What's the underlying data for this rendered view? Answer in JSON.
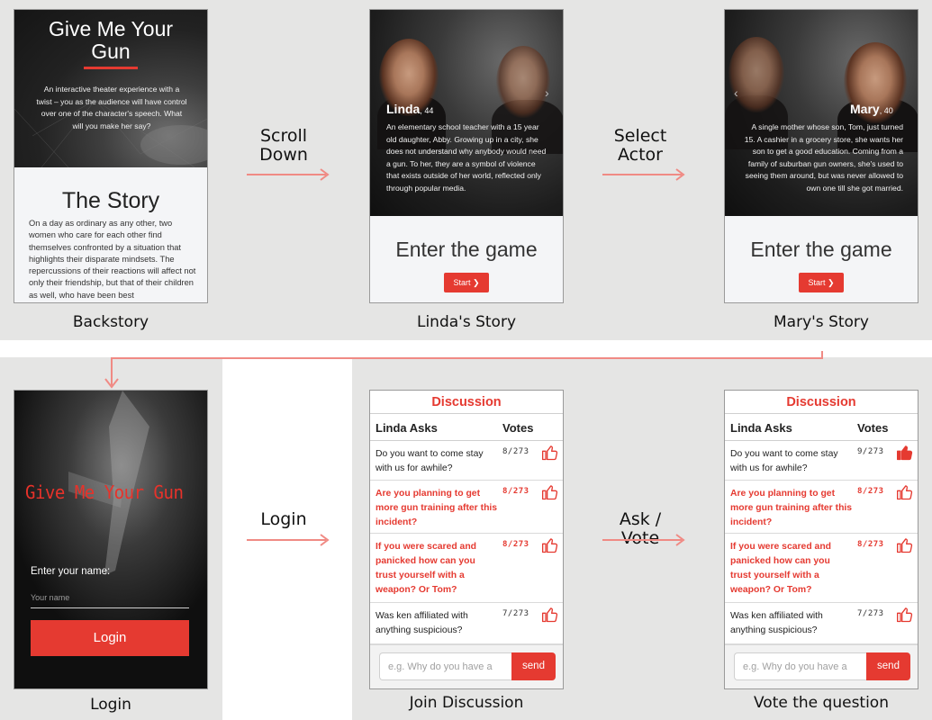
{
  "panels": {
    "backstory": {
      "caption": "Backstory",
      "title_line1": "Give Me Your",
      "title_line2": "Gun",
      "intro": "An interactive theater experience with a twist – you as the audience will have control over one of the character's speech. What will you make her say?",
      "story_heading": "The Story",
      "story_text": "On a day as ordinary as any other, two women who care for each other find themselves confronted by a situation that highlights their disparate mindsets. The repercussions of their reactions will affect not only their friendship, but that of their children as well, who have been best"
    },
    "linda_story": {
      "caption": "Linda's Story",
      "name": "Linda",
      "age": ", 44",
      "bio": "An elementary school teacher with a 15 year old daughter, Abby. Growing up in a city, she does not understand why anybody would need a gun. To her, they are a symbol of violence that exists outside of her world, reflected only through popular media.",
      "enter_label": "Enter the game",
      "start_label": "Start"
    },
    "mary_story": {
      "caption": "Mary's Story",
      "name": "Mary",
      "age": ", 40",
      "bio": "A single mother whose son, Tom, just turned 15. A cashier in a grocery store, she wants her son to get a good education. Coming from a family of suburban gun owners, she's used to seeing them around, but was never allowed to own one till she got married.",
      "enter_label": "Enter the game",
      "start_label": "Start"
    },
    "login": {
      "caption": "Login",
      "brand": "Give Me Your Gun",
      "name_prompt": "Enter your name:",
      "name_placeholder": "Your name",
      "login_label": "Login"
    },
    "join_discussion": {
      "caption": "Join Discussion",
      "title": "Discussion",
      "col_question": "Linda Asks",
      "col_votes": "Votes",
      "questions": [
        {
          "text": "Do you want to come stay with us for awhile?",
          "votes": "8/273",
          "highlight": false,
          "liked": false
        },
        {
          "text": "Are you planning to get more gun training after this incident?",
          "votes": "8/273",
          "highlight": true,
          "liked": false
        },
        {
          "text": "If you were scared and panicked how can you trust yourself with a weapon? Or Tom?",
          "votes": "8/273",
          "highlight": true,
          "liked": false
        },
        {
          "text": "Was ken affiliated with anything suspicious?",
          "votes": "7/273",
          "highlight": false,
          "liked": false
        }
      ],
      "input_placeholder": "e.g. Why do you have a",
      "send_label": "send"
    },
    "vote_question": {
      "caption": "Vote the question",
      "title": "Discussion",
      "col_question": "Linda Asks",
      "col_votes": "Votes",
      "questions": [
        {
          "text": "Do you want to come stay with us for awhile?",
          "votes": "9/273",
          "highlight": false,
          "liked": true
        },
        {
          "text": "Are you planning to get more gun training after this incident?",
          "votes": "8/273",
          "highlight": true,
          "liked": false
        },
        {
          "text": "If you were scared and panicked how can you trust yourself with a weapon? Or Tom?",
          "votes": "8/273",
          "highlight": true,
          "liked": false
        },
        {
          "text": "Was ken affiliated with anything suspicious?",
          "votes": "7/273",
          "highlight": false,
          "liked": false
        }
      ],
      "input_placeholder": "e.g. Why do you have a",
      "send_label": "send"
    }
  },
  "flow_labels": {
    "scroll_down_1": "Scroll",
    "scroll_down_2": "Down",
    "select_actor_1": "Select",
    "select_actor_2": "Actor",
    "login": "Login",
    "ask_vote": "Ask / Vote"
  },
  "icons": {
    "thumbs_up": "thumbs-up-icon",
    "chevron_right": "chevron-right-icon",
    "chevron_left": "chevron-left-icon",
    "flow_arrow": "arrow-right-icon"
  },
  "colors": {
    "accent": "#e53a31",
    "flow_arrow": "#f08a84",
    "panel_bg": "#e5e5e4"
  }
}
